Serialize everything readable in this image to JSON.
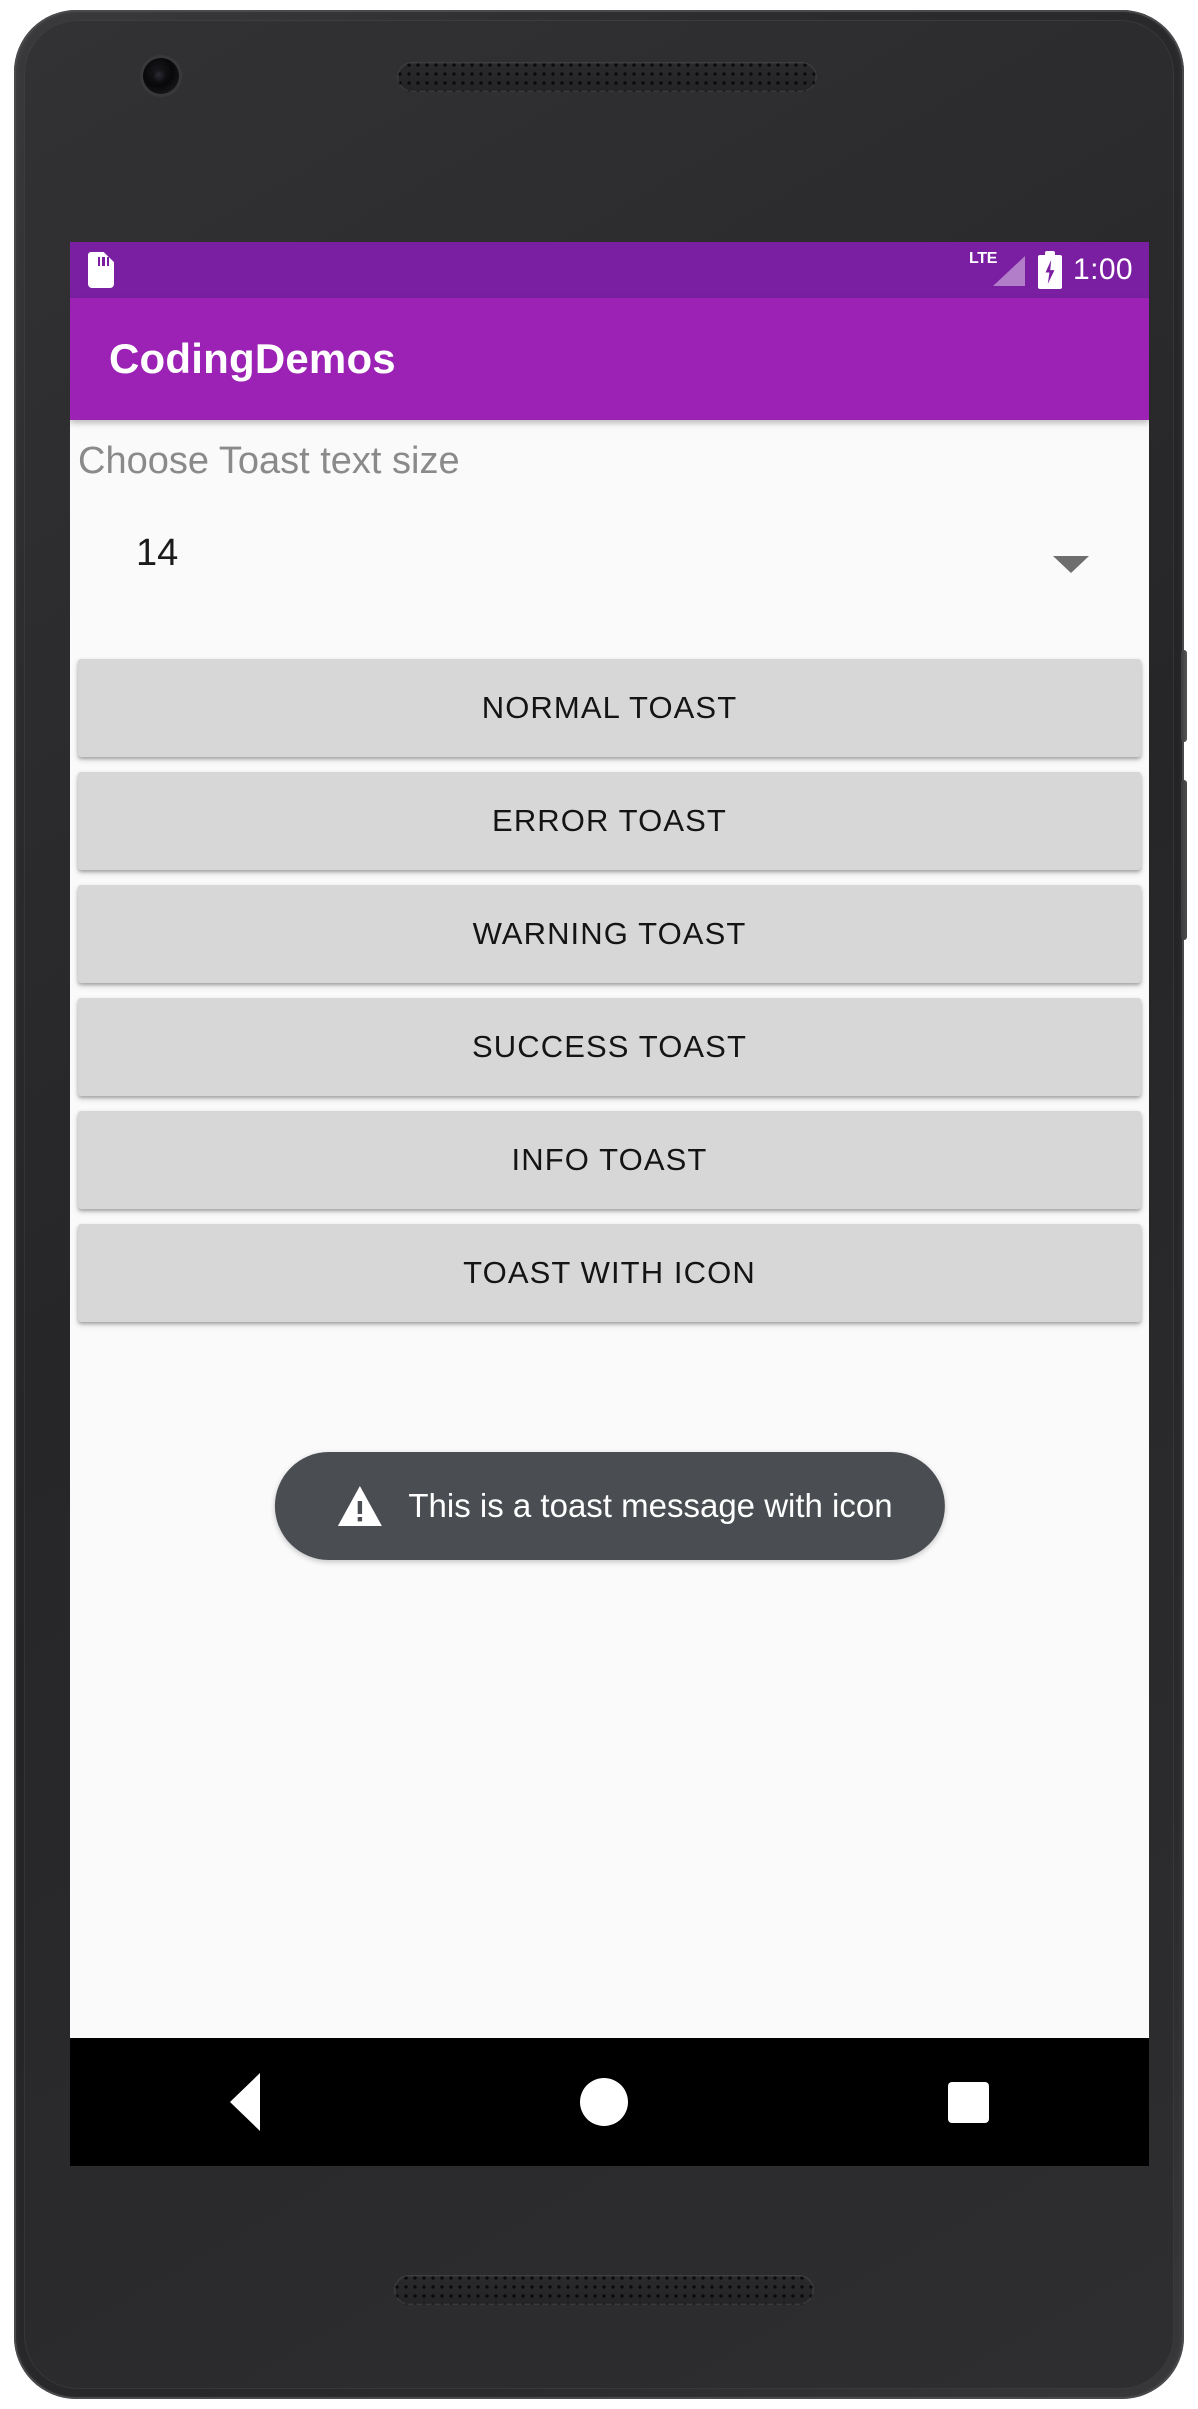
{
  "device": {
    "front_camera_icon": "camera-icon",
    "earpiece_icon": "speaker-grille-icon",
    "bottom_speaker_icon": "speaker-grille-icon"
  },
  "status_bar": {
    "sd_card_icon": "sd-card-icon",
    "network_label": "LTE",
    "signal_icon": "signal-triangle-icon",
    "battery_icon": "battery-charging-icon",
    "clock": "1:00",
    "background_color": "#7B1FA2"
  },
  "app_bar": {
    "title": "CodingDemos",
    "background_color": "#9C21B5"
  },
  "content": {
    "spinner_label": "Choose Toast text size",
    "spinner": {
      "selected_value": "14",
      "dropdown_icon": "chevron-down-icon"
    },
    "buttons": [
      {
        "label": "NORMAL TOAST",
        "name": "normal-toast-button"
      },
      {
        "label": "ERROR TOAST",
        "name": "error-toast-button"
      },
      {
        "label": "WARNING TOAST",
        "name": "warning-toast-button"
      },
      {
        "label": "SUCCESS TOAST",
        "name": "success-toast-button"
      },
      {
        "label": "INFO TOAST",
        "name": "info-toast-button"
      },
      {
        "label": "TOAST WITH ICON",
        "name": "toast-with-icon-button"
      }
    ],
    "button_background_color": "#D6D7D6"
  },
  "toast": {
    "message": "This is a toast message with icon",
    "icon": "warning-triangle-icon",
    "background_color": "#4A4E53"
  },
  "nav_bar": {
    "back_icon": "back-triangle-icon",
    "home_icon": "home-circle-icon",
    "recents_icon": "recents-square-icon",
    "background_color": "#000000"
  }
}
